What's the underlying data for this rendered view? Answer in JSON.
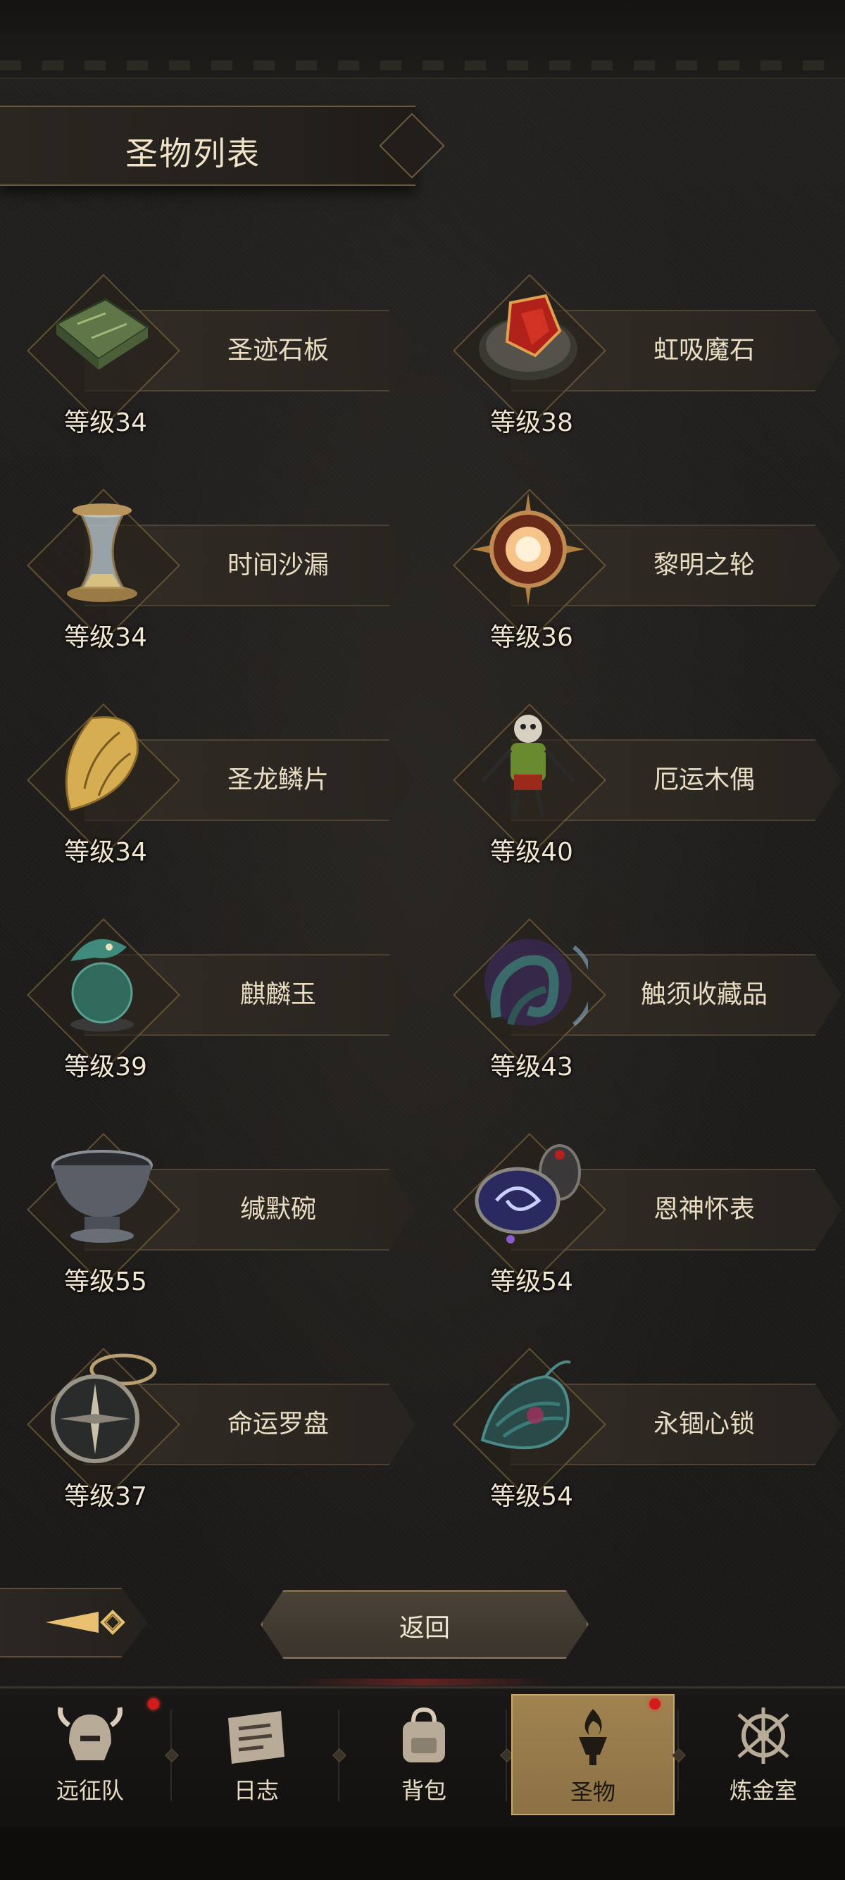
{
  "header": {
    "title": "圣物列表"
  },
  "relics": [
    {
      "name": "圣迹石板",
      "level": "等级34",
      "icon": "stone-tablet-icon",
      "color": "#6f8a52"
    },
    {
      "name": "虹吸魔石",
      "level": "等级38",
      "icon": "siphon-stone-icon",
      "color": "#c0281d"
    },
    {
      "name": "时间沙漏",
      "level": "等级34",
      "icon": "hourglass-icon",
      "color": "#c7a868"
    },
    {
      "name": "黎明之轮",
      "level": "等级36",
      "icon": "dawn-wheel-icon",
      "color": "#f2b070"
    },
    {
      "name": "圣龙鳞片",
      "level": "等级34",
      "icon": "dragon-scale-icon",
      "color": "#e0b85a"
    },
    {
      "name": "厄运木偶",
      "level": "等级40",
      "icon": "doom-puppet-icon",
      "color": "#7a9a3a"
    },
    {
      "name": "麒麟玉",
      "level": "等级39",
      "icon": "qilin-jade-icon",
      "color": "#3f8a7a"
    },
    {
      "name": "触须收藏品",
      "level": "等级43",
      "icon": "tentacle-collectible-icon",
      "color": "#3a6a6a"
    },
    {
      "name": "缄默碗",
      "level": "等级55",
      "icon": "silent-bowl-icon",
      "color": "#7a7f88"
    },
    {
      "name": "恩神怀表",
      "level": "等级54",
      "icon": "pocket-watch-icon",
      "color": "#6a5ad0"
    },
    {
      "name": "命运罗盘",
      "level": "等级37",
      "icon": "fate-compass-icon",
      "color": "#8a8a80"
    },
    {
      "name": "永锢心锁",
      "level": "等级54",
      "icon": "heart-lock-icon",
      "color": "#3a7a78"
    }
  ],
  "footer": {
    "return_label": "返回"
  },
  "nav": {
    "tabs": [
      {
        "label": "远征队",
        "icon": "helmet-icon",
        "badge": true,
        "active": false
      },
      {
        "label": "日志",
        "icon": "journal-icon",
        "badge": false,
        "active": false
      },
      {
        "label": "背包",
        "icon": "backpack-icon",
        "badge": false,
        "active": false
      },
      {
        "label": "圣物",
        "icon": "relic-torch-icon",
        "badge": true,
        "active": true
      },
      {
        "label": "炼金室",
        "icon": "alchemy-icon",
        "badge": false,
        "active": false
      }
    ]
  },
  "colors": {
    "accent_gold": "#c8a86a",
    "badge_red": "#d21b1b",
    "background": "#1c1a17"
  }
}
